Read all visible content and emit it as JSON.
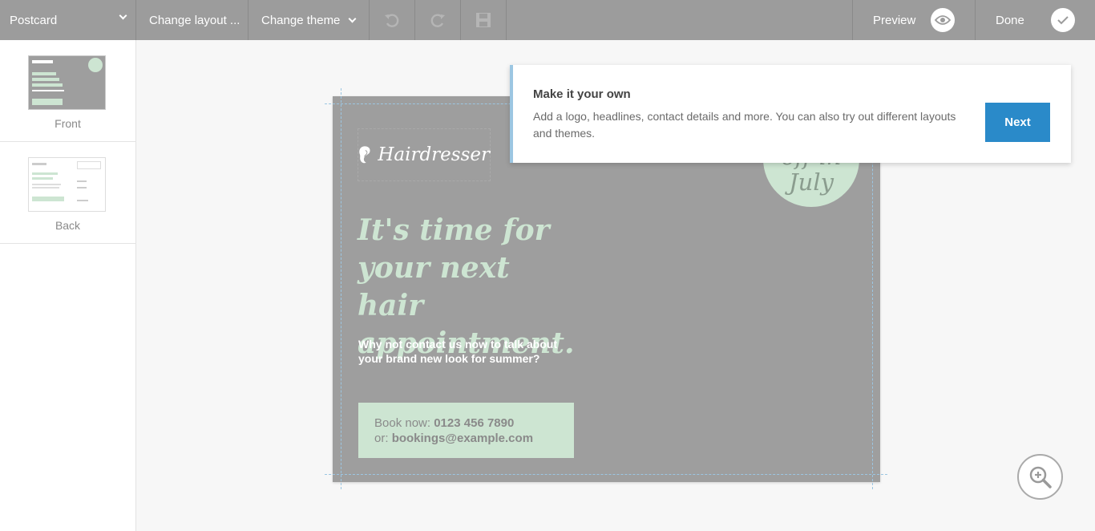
{
  "toolbar": {
    "product_select": "Postcard",
    "change_layout": "Change layout ...",
    "change_theme": "Change theme",
    "preview": "Preview",
    "done": "Done"
  },
  "pages": [
    {
      "label": "Front"
    },
    {
      "label": "Back"
    }
  ],
  "card": {
    "logo_text": "Hairdresser",
    "headline_lines": [
      "It's time for",
      "your next hair",
      "appointment."
    ],
    "subtext_lines": [
      "Why not contact us now to talk about",
      "your brand new look for summer?"
    ],
    "book_prefix": "Book now: ",
    "phone": "0123 456 7890",
    "email_prefix": "or: ",
    "email": "bookings@example.com",
    "badge_top": "off in",
    "badge_bottom": "July"
  },
  "tooltip": {
    "title": "Make it your own",
    "body": "Add a logo, headlines, contact details and more. You can also try out different layouts and themes.",
    "next": "Next"
  },
  "colors": {
    "toolbar": "#9c9c9c",
    "accent_blue": "#2a8ac9",
    "mint": "#cde5d2",
    "card_bg": "#9e9e9e"
  }
}
